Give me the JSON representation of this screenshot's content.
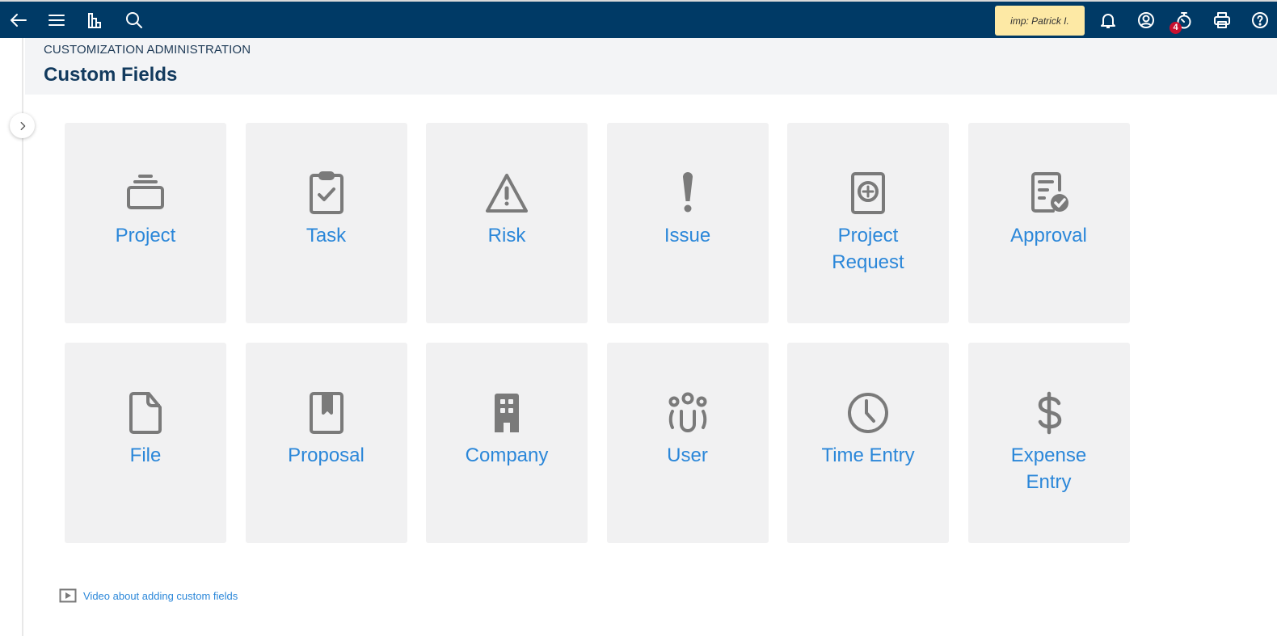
{
  "topbar": {
    "impersonation_label": "imp: Patrick I.",
    "notification_count": "4",
    "icons": [
      "back-arrow-icon",
      "menu-icon",
      "chart-icon",
      "search-icon",
      "bell-icon",
      "user-circle-icon",
      "stopwatch-icon",
      "printer-icon",
      "help-icon"
    ]
  },
  "header": {
    "breadcrumb": "CUSTOMIZATION ADMINISTRATION",
    "title": "Custom Fields"
  },
  "tiles": [
    {
      "label": "Project",
      "icon": "project-stack-icon"
    },
    {
      "label": "Task",
      "icon": "clipboard-check-icon"
    },
    {
      "label": "Risk",
      "icon": "warning-triangle-icon"
    },
    {
      "label": "Issue",
      "icon": "exclamation-icon"
    },
    {
      "label": "Project Request",
      "icon": "request-plus-icon"
    },
    {
      "label": "Approval",
      "icon": "document-check-icon"
    },
    {
      "label": "File",
      "icon": "file-icon"
    },
    {
      "label": "Proposal",
      "icon": "bookmark-book-icon"
    },
    {
      "label": "Company",
      "icon": "building-icon"
    },
    {
      "label": "User",
      "icon": "users-group-icon"
    },
    {
      "label": "Time Entry",
      "icon": "clock-icon"
    },
    {
      "label": "Expense Entry",
      "icon": "dollar-icon"
    }
  ],
  "footer": {
    "video_link": "Video about adding custom fields"
  },
  "colors": {
    "topbar": "#003a66",
    "accent_link": "#2b87d9",
    "tile_bg": "#f1f1f2",
    "icon_gray": "#7a7a7a",
    "badge_red": "#c8102e",
    "imp_badge": "#fde9a5"
  }
}
